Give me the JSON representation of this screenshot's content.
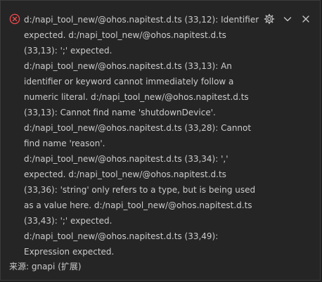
{
  "notification": {
    "message": "d:/napi_tool_new/@ohos.napitest.d.ts (33,12): Identifier expected. d:/napi_tool_new/@ohos.napitest.d.ts (33,13): ';' expected. d:/napi_tool_new/@ohos.napitest.d.ts (33,13): An identifier or keyword cannot immediately follow a numeric literal. d:/napi_tool_new/@ohos.napitest.d.ts (33,13): Cannot find name 'shutdownDevice'. d:/napi_tool_new/@ohos.napitest.d.ts (33,28): Cannot find name 'reason'. d:/napi_tool_new/@ohos.napitest.d.ts (33,34): ',' expected. d:/napi_tool_new/@ohos.napitest.d.ts (33,36): 'string' only refers to a type, but is being used as a value here. d:/napi_tool_new/@ohos.napitest.d.ts (33,43): ';' expected. d:/napi_tool_new/@ohos.napitest.d.ts (33,49): Expression expected.",
    "source": "来源: gnapi (扩展)",
    "icons": {
      "severity": "error-icon",
      "settings": "gear-icon",
      "collapse": "chevron-down-icon",
      "close": "close-icon"
    },
    "colors": {
      "error": "#f14c4c",
      "text": "#cccccc",
      "background": "#252526",
      "icon": "#c5c5c5"
    }
  }
}
